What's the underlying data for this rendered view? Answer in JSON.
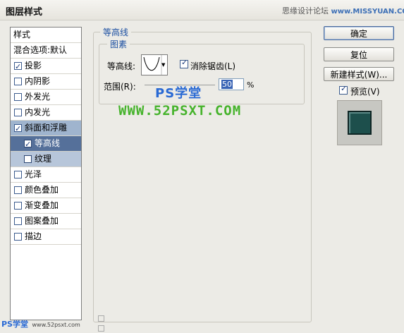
{
  "window": {
    "title": "图层样式",
    "watermark": "思缘设计论坛",
    "watermark_url": "www.MISSYUAN.COM"
  },
  "sidebar": {
    "items": [
      {
        "label": "样式",
        "checkbox": false,
        "checked": false
      },
      {
        "label": "混合选项:默认",
        "checkbox": false,
        "checked": false
      },
      {
        "label": "投影",
        "checkbox": true,
        "checked": true
      },
      {
        "label": "内阴影",
        "checkbox": true,
        "checked": false
      },
      {
        "label": "外发光",
        "checkbox": true,
        "checked": false
      },
      {
        "label": "内发光",
        "checkbox": true,
        "checked": false
      },
      {
        "label": "斜面和浮雕",
        "checkbox": true,
        "checked": true
      },
      {
        "label": "等高线",
        "checkbox": true,
        "checked": true,
        "sub": true
      },
      {
        "label": "纹理",
        "checkbox": true,
        "checked": false,
        "sub": true
      },
      {
        "label": "光泽",
        "checkbox": true,
        "checked": false
      },
      {
        "label": "颜色叠加",
        "checkbox": true,
        "checked": false
      },
      {
        "label": "渐变叠加",
        "checkbox": true,
        "checked": false
      },
      {
        "label": "图案叠加",
        "checkbox": true,
        "checked": false
      },
      {
        "label": "描边",
        "checkbox": true,
        "checked": false
      }
    ]
  },
  "panel": {
    "group_title": "等高线",
    "elements_title": "图素",
    "contour_label": "等高线:",
    "antialias_label": "消除锯齿(L)",
    "antialias_checked": true,
    "range_label": "范围(R):",
    "range_value": "50",
    "range_unit": "%"
  },
  "buttons": {
    "ok": "确定",
    "reset": "复位",
    "new_style": "新建样式(W)...",
    "preview_label": "预览(V)",
    "preview_checked": true
  },
  "watermarks": {
    "center": "PS学堂",
    "url": "WWW.52PSXT.COM",
    "bottom_ps": "PS学堂",
    "bottom_url": "www.52psxt.com"
  },
  "colors": {
    "selected": "#9fb4ce",
    "active": "#55709a",
    "accent_blue": "#1a4ea1",
    "preview": "#1d4f4c"
  }
}
